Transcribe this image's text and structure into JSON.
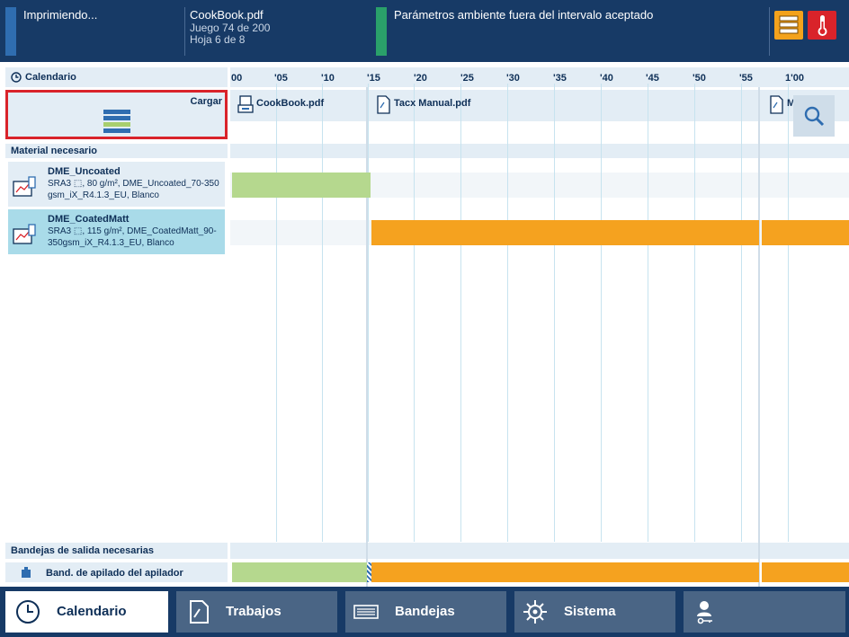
{
  "topbar": {
    "status": "Imprimiendo...",
    "job_name": "CookBook.pdf",
    "job_set": "Juego 74 de 200",
    "job_sheet": "Hoja 6 de 8",
    "warning": "Parámetros ambiente fuera del intervalo aceptado",
    "colors": {
      "bar": "#173a66",
      "accent_blue": "#2f6db0",
      "accent_green": "#2aa06a",
      "icon_orange": "#f3a21c",
      "icon_red": "#d9232a"
    },
    "icons": [
      "stack-icon",
      "thermometer-icon"
    ]
  },
  "left": {
    "calendar_label": "Calendario",
    "load_label": "Cargar",
    "media_needed": "Material necesario",
    "media": [
      {
        "name": "DME_Uncoated",
        "desc": "SRA3 ⬚, 80 g/m², DME_Uncoated_70-350 gsm_iX_R4.1.3_EU, Blanco"
      },
      {
        "name": "DME_CoatedMatt",
        "desc": "SRA3 ⬚, 115 g/m², DME_CoatedMatt_90-350gsm_iX_R4.1.3_EU, Blanco"
      }
    ],
    "output_needed": "Bandejas de salida necesarias",
    "output_tray": "Band. de apilado del apilador"
  },
  "timeline": {
    "ticks": [
      "00",
      "'05",
      "'10",
      "'15",
      "'20",
      "'25",
      "'30",
      "'35",
      "'40",
      "'45",
      "'50",
      "'55",
      "1'00"
    ],
    "jobs": [
      "CookBook.pdf",
      "Tacx Manual.pdf",
      "M"
    ],
    "colors": {
      "green": "#b5d88e",
      "orange": "#f5a21f",
      "grid": "#c7e3ef",
      "band": "#e3edf5"
    },
    "zoom_icon": "magnifier-icon"
  },
  "nav": {
    "items": [
      {
        "label": "Calendario",
        "icon": "clock-icon"
      },
      {
        "label": "Trabajos",
        "icon": "document-icon"
      },
      {
        "label": "Bandejas",
        "icon": "trays-icon"
      },
      {
        "label": "Sistema",
        "icon": "gear-icon"
      },
      {
        "label": "",
        "icon": "user-key-icon"
      }
    ]
  }
}
